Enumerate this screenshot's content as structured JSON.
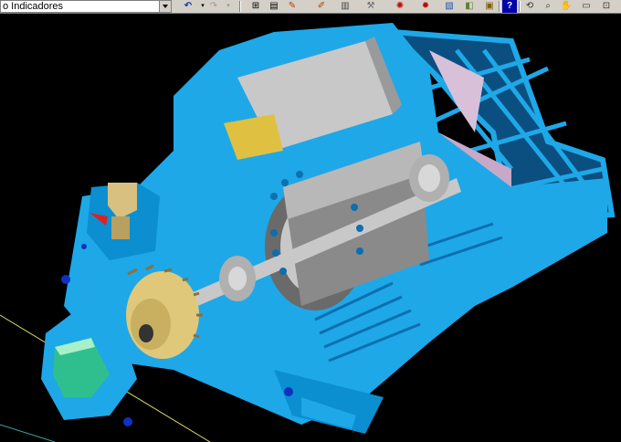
{
  "toolbar": {
    "combo_value": "o Indicadores",
    "icons": [
      "undo-icon",
      "redo-icon",
      "zoom-icon",
      "document-icon",
      "pencil-icon",
      "edit-icon",
      "layers-icon",
      "sun-icon",
      "image-icon",
      "palette-icon",
      "folder-icon",
      "help-icon",
      "refresh-icon",
      "magnifier-icon",
      "hand-icon",
      "window-icon"
    ],
    "colors": {
      "background": "#d4d0c8",
      "accent": "#0000aa"
    }
  },
  "viewport": {
    "description_colors": {
      "casing": "#1ea8e8",
      "casing_dark": "#0b6fb0",
      "shaft": "#c8c8c8",
      "gear": "#e0c87a",
      "fan": "#d8c0d8",
      "seal": "#2fbf8f"
    }
  }
}
